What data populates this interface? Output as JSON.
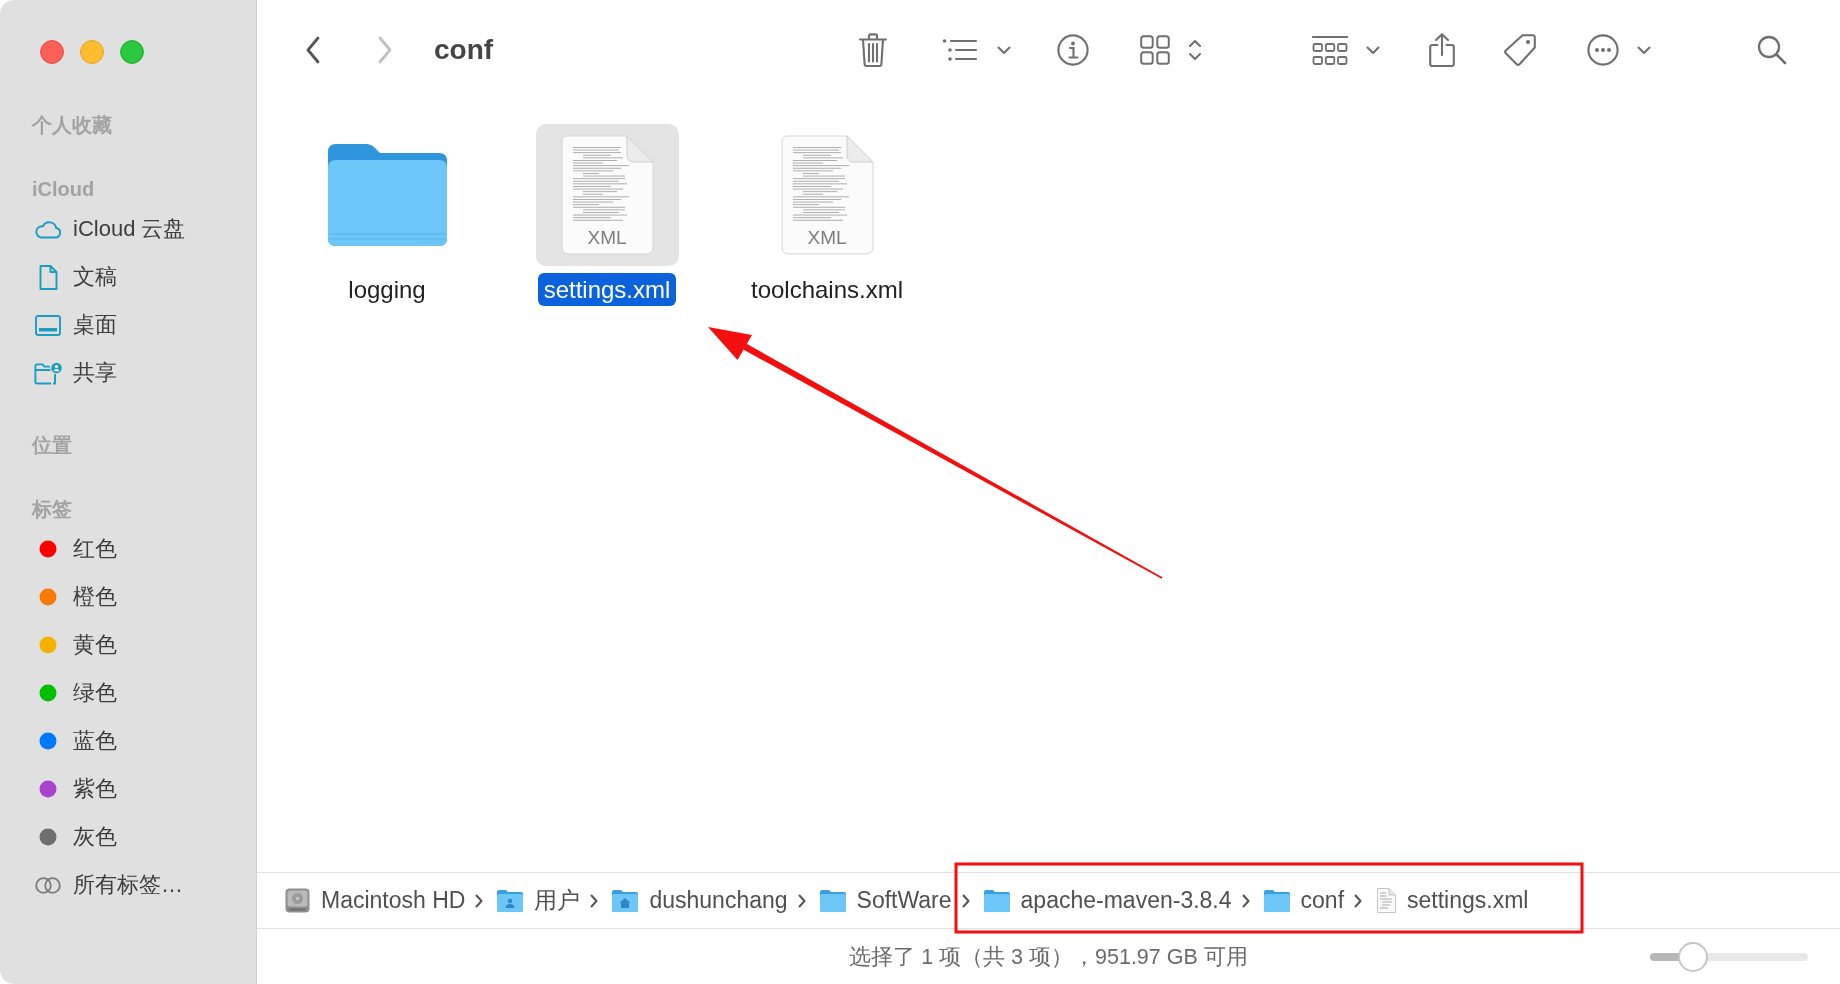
{
  "window": {
    "title": "conf"
  },
  "navigation": {
    "back": {
      "disabled": false
    },
    "forward": {
      "disabled": true
    }
  },
  "sidebar": {
    "sections": [
      {
        "title": "个人收藏"
      },
      {
        "title": "iCloud",
        "items": [
          {
            "label": "iCloud 云盘",
            "kind": "cloud"
          },
          {
            "label": "文稿",
            "kind": "document"
          },
          {
            "label": "桌面",
            "kind": "desktop"
          },
          {
            "label": "共享",
            "kind": "shared"
          }
        ]
      },
      {
        "title": "位置"
      },
      {
        "title": "标签",
        "items": [
          {
            "label": "红色",
            "kind": "tag",
            "color": "#fe0000"
          },
          {
            "label": "橙色",
            "kind": "tag",
            "color": "#f77b00"
          },
          {
            "label": "黄色",
            "kind": "tag",
            "color": "#f3b200"
          },
          {
            "label": "绿色",
            "kind": "tag",
            "color": "#00bf00"
          },
          {
            "label": "蓝色",
            "kind": "tag",
            "color": "#0078ff"
          },
          {
            "label": "紫色",
            "kind": "tag",
            "color": "#a744cb"
          },
          {
            "label": "灰色",
            "kind": "tag",
            "color": "#6d6d72"
          },
          {
            "label": "所有标签…",
            "kind": "all-tags"
          }
        ]
      }
    ]
  },
  "files": [
    {
      "name": "logging",
      "kind": "folder",
      "selected": false
    },
    {
      "name": "settings.xml",
      "kind": "document",
      "type_label": "XML",
      "selected": true
    },
    {
      "name": "toolchains.xml",
      "kind": "document",
      "type_label": "XML",
      "selected": false
    }
  ],
  "path_bar": [
    {
      "name": "Macintosh HD",
      "kind": "disk"
    },
    {
      "name": "用户",
      "kind": "users-folder"
    },
    {
      "name": "dushunchang",
      "kind": "home-folder"
    },
    {
      "name": "SoftWare",
      "kind": "folder"
    },
    {
      "name": "apache-maven-3.8.4",
      "kind": "folder"
    },
    {
      "name": "conf",
      "kind": "folder"
    },
    {
      "name": "settings.xml",
      "kind": "document"
    }
  ],
  "status_bar": {
    "text": "选择了 1 项（共 3 项），951.97 GB 可用"
  },
  "icon_size_slider": {
    "level": 0.27
  },
  "annotations": {
    "arrow": true,
    "highlight_frame": true
  }
}
